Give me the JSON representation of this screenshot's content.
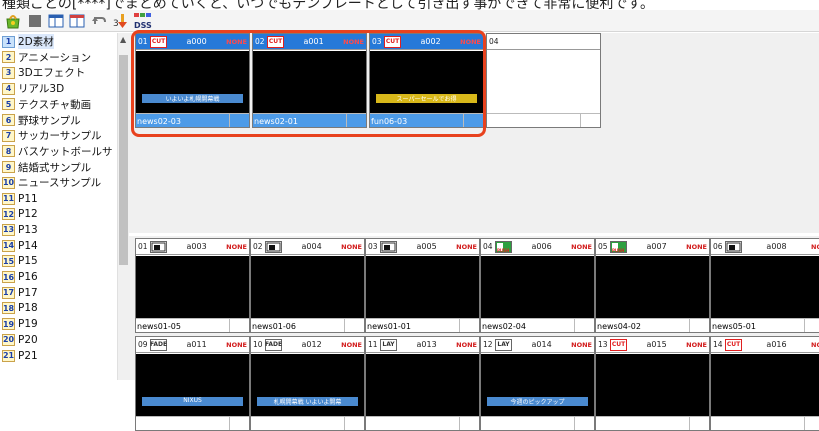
{
  "top_strip_text": "種類ごとの[****]でまとめていくと、いつでもテンプレートとして引き出す事ができて非常に便利です。",
  "toolbar": {
    "icons": [
      "bag-icon",
      "stop-icon",
      "layout-icon",
      "window-icon",
      "undo-icon",
      "import-icon",
      "dss-icon"
    ],
    "dss_label": "DSS"
  },
  "sidebar": {
    "items": [
      {
        "num": "1",
        "label": "2D素材",
        "selected": true
      },
      {
        "num": "2",
        "label": "アニメーション"
      },
      {
        "num": "3",
        "label": "3Dエフェクト"
      },
      {
        "num": "4",
        "label": "リアル3D"
      },
      {
        "num": "5",
        "label": "テクスチャ動画"
      },
      {
        "num": "6",
        "label": "野球サンプル"
      },
      {
        "num": "7",
        "label": "サッカーサンプル"
      },
      {
        "num": "8",
        "label": "バスケットボールサ"
      },
      {
        "num": "9",
        "label": "結婚式サンプル"
      },
      {
        "num": "10",
        "label": "ニュースサンプル"
      },
      {
        "num": "11",
        "label": "P11"
      },
      {
        "num": "12",
        "label": "P12"
      },
      {
        "num": "13",
        "label": "P13"
      },
      {
        "num": "14",
        "label": "P14"
      },
      {
        "num": "15",
        "label": "P15"
      },
      {
        "num": "16",
        "label": "P16"
      },
      {
        "num": "17",
        "label": "P17"
      },
      {
        "num": "18",
        "label": "P18"
      },
      {
        "num": "19",
        "label": "P19"
      },
      {
        "num": "20",
        "label": "P20"
      },
      {
        "num": "21",
        "label": "P21"
      }
    ]
  },
  "upper_panel": {
    "cells": [
      {
        "index": "01",
        "trans": "CUT",
        "code": "a000",
        "badge": "NONE",
        "file": "news02-03",
        "overlay": "いよいよ札幌開幕戦",
        "selected": true
      },
      {
        "index": "02",
        "trans": "CUT",
        "code": "a001",
        "badge": "NONE",
        "file": "news02-01",
        "selected": true
      },
      {
        "index": "03",
        "trans": "CUT",
        "code": "a002",
        "badge": "NONE",
        "file": "fun06-03",
        "overlay": "スーパーセールでお得",
        "selected": true
      },
      {
        "index": "04",
        "trans": "",
        "code": "",
        "badge": "",
        "file": ""
      }
    ]
  },
  "lower_panel": {
    "row1": [
      {
        "index": "01",
        "trans": "",
        "code": "a003",
        "badge": "NONE",
        "file": "news01-05"
      },
      {
        "index": "02",
        "trans": "",
        "code": "a004",
        "badge": "NONE",
        "file": "news01-06"
      },
      {
        "index": "03",
        "trans": "",
        "code": "a005",
        "badge": "NONE",
        "file": "news01-01"
      },
      {
        "index": "04",
        "trans": "PUSH",
        "code": "a006",
        "badge": "NONE",
        "file": "news02-04"
      },
      {
        "index": "05",
        "trans": "PUSH",
        "code": "a007",
        "badge": "NONE",
        "file": "news04-02"
      },
      {
        "index": "06",
        "trans": "",
        "code": "a008",
        "badge": "NO",
        "file": "news05-01"
      }
    ],
    "row2": [
      {
        "index": "09",
        "trans": "FADE",
        "code": "a011",
        "badge": "NONE",
        "overlay": "NIXUS"
      },
      {
        "index": "10",
        "trans": "FADE",
        "code": "a012",
        "badge": "NONE",
        "overlay": "札幌開幕戦 いよいよ開幕"
      },
      {
        "index": "11",
        "trans": "LAY",
        "code": "a013",
        "badge": "NONE"
      },
      {
        "index": "12",
        "trans": "LAY",
        "code": "a014",
        "badge": "NONE",
        "overlay": "今週のピックアップ"
      },
      {
        "index": "13",
        "trans": "CUT",
        "code": "a015",
        "badge": "NONE"
      },
      {
        "index": "14",
        "trans": "CUT",
        "code": "a016",
        "badge": "NO"
      }
    ]
  },
  "colors": {
    "selection": "#2679d8",
    "ring": "#e8421e",
    "none_badge": "#d21b1b"
  }
}
